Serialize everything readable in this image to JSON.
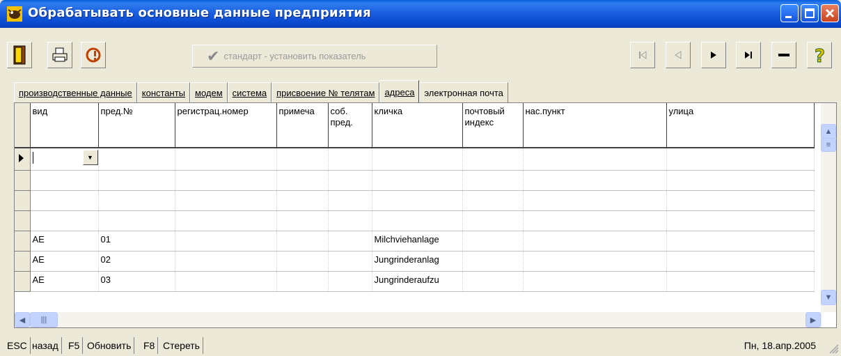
{
  "window": {
    "title": "Обрабатывать основные данные предприятия",
    "icon": "cow-app-icon",
    "accent": "#0B4BD0"
  },
  "toolbar": {
    "exit_icon": "door-exit-icon",
    "print_icon": "printer-icon",
    "alert_icon": "exclamation-icon",
    "standard_button_label": "стандарт - установить показатель",
    "standard_button_icon": "checkmark-icon",
    "first_icon": "first-record-icon",
    "prev_icon": "previous-record-icon",
    "next_icon": "next-record-icon",
    "last_icon": "last-record-icon",
    "delete_icon": "minus-icon",
    "help_icon": "help-question-icon"
  },
  "tabs": [
    {
      "label": "производственные данные",
      "active": false
    },
    {
      "label": "константы",
      "active": false
    },
    {
      "label": "модем",
      "active": false
    },
    {
      "label": "система",
      "active": false
    },
    {
      "label": "присвоение № телятам",
      "active": false
    },
    {
      "label": "адреса",
      "active": true
    },
    {
      "label": "электронная почта",
      "active": false
    }
  ],
  "grid": {
    "columns": [
      "вид",
      "пред.№",
      "регистрац.номер",
      "примеча",
      "соб. пред.",
      "кличка",
      "почтовый индекс",
      "нас.пункт",
      "улица"
    ],
    "rows": [
      [
        "AE",
        "01",
        "",
        "",
        "",
        "Milchviehanlage",
        "",
        "",
        ""
      ],
      [
        "AE",
        "02",
        "",
        "",
        "",
        "Jungrinderanlag",
        "",
        "",
        ""
      ],
      [
        "AE",
        "03",
        "",
        "",
        "",
        "Jungrinderaufzu",
        "",
        "",
        ""
      ]
    ]
  },
  "statusbar": {
    "keys": [
      {
        "key": "ESC",
        "label": "назад"
      },
      {
        "key": "F5",
        "label": "Обновить"
      },
      {
        "key": "F8",
        "label": "Стереть"
      }
    ],
    "date": "Пн, 18.апр.2005"
  }
}
